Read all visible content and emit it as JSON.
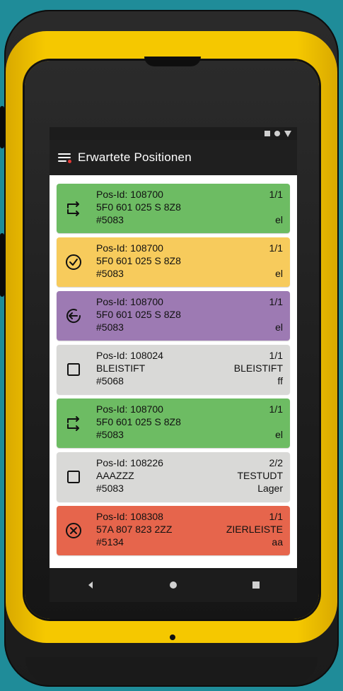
{
  "app": {
    "title": "Erwartete Positionen"
  },
  "colors": {
    "green": "#6dbc63",
    "yellow": "#f7cb5c",
    "purple": "#9d7ab3",
    "gray": "#d9d9d7",
    "red": "#e6654c"
  },
  "items": [
    {
      "pos": "Pos-Id: 108700",
      "qty": "1/1",
      "article": "5F0 601 025 S 8Z8",
      "article_right": "",
      "order": "#5083",
      "location": "el",
      "color": "green",
      "icon": "transfer-icon"
    },
    {
      "pos": "Pos-Id: 108700",
      "qty": "1/1",
      "article": "5F0 601 025 S 8Z8",
      "article_right": "",
      "order": "#5083",
      "location": "el",
      "color": "yellow",
      "icon": "check-circle-icon"
    },
    {
      "pos": "Pos-Id: 108700",
      "qty": "1/1",
      "article": "5F0 601 025 S 8Z8",
      "article_right": "",
      "order": "#5083",
      "location": "el",
      "color": "purple",
      "icon": "return-circle-icon"
    },
    {
      "pos": "Pos-Id: 108024",
      "qty": "1/1",
      "article": "BLEISTIFT",
      "article_right": "BLEISTIFT",
      "order": "#5068",
      "location": "ff",
      "color": "gray",
      "icon": "checkbox-icon"
    },
    {
      "pos": "Pos-Id: 108700",
      "qty": "1/1",
      "article": "5F0 601 025 S 8Z8",
      "article_right": "",
      "order": "#5083",
      "location": "el",
      "color": "green",
      "icon": "transfer-icon"
    },
    {
      "pos": "Pos-Id: 108226",
      "qty": "2/2",
      "article": "AAAZZZ",
      "article_right": "TESTUDT",
      "order": "#5083",
      "location": "Lager",
      "color": "gray",
      "icon": "checkbox-icon"
    },
    {
      "pos": "Pos-Id: 108308",
      "qty": "1/1",
      "article": "57A 807 823 2ZZ",
      "article_right": "ZIERLEISTE",
      "order": "#5134",
      "location": "aa",
      "color": "red",
      "icon": "cancel-circle-icon"
    }
  ]
}
